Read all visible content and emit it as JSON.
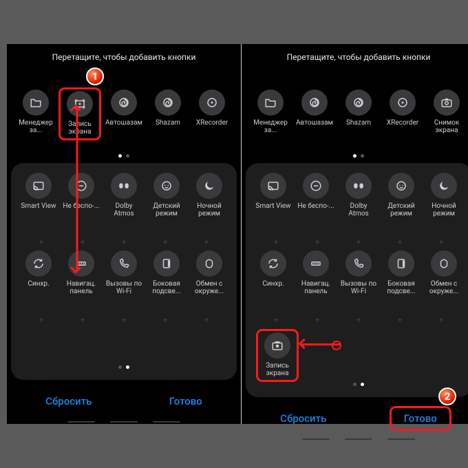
{
  "instruction": "Перетащите, чтобы добавить кнопки",
  "footer": {
    "reset": "Сбросить",
    "done": "Готово"
  },
  "badges": {
    "one": "1",
    "two": "2"
  },
  "left": {
    "available": [
      {
        "label": "Менеджер за...",
        "icon": "folder"
      },
      {
        "label": "Запись экрана",
        "icon": "record"
      },
      {
        "label": "Автошазам",
        "icon": "swirl"
      },
      {
        "label": "Shazam",
        "icon": "swirl"
      },
      {
        "label": "XRecorder",
        "icon": "disc"
      }
    ],
    "panel_r1": [
      {
        "label": "Smart View",
        "icon": "cast"
      },
      {
        "label": "Не беспо-...",
        "icon": "minus"
      },
      {
        "label": "Dolby Atmos",
        "icon": "dolby"
      },
      {
        "label": "Детский режим",
        "icon": "kid"
      },
      {
        "label": "Ночной режим",
        "icon": "moon"
      }
    ],
    "panel_r2": [
      {
        "label": "Синхр.",
        "icon": "sync"
      },
      {
        "label": "Навигац. панель",
        "icon": "nav"
      },
      {
        "label": "Вызовы по Wi-Fi",
        "icon": "wifi-call"
      },
      {
        "label": "Боковая подсве...",
        "icon": "edge"
      },
      {
        "label": "Обмен с окруже...",
        "icon": "share"
      }
    ]
  },
  "right": {
    "available": [
      {
        "label": "Менеджер за...",
        "icon": "folder"
      },
      {
        "label": "Автошазам",
        "icon": "swirl"
      },
      {
        "label": "Shazam",
        "icon": "swirl"
      },
      {
        "label": "XRecorder",
        "icon": "disc"
      },
      {
        "label": "Снимок экрана",
        "icon": "camera"
      }
    ],
    "panel_r1": [
      {
        "label": "Smart View",
        "icon": "cast"
      },
      {
        "label": "Не беспо-...",
        "icon": "minus"
      },
      {
        "label": "Dolby Atmos",
        "icon": "dolby"
      },
      {
        "label": "Детский режим",
        "icon": "kid"
      },
      {
        "label": "Ночной режим",
        "icon": "moon"
      }
    ],
    "panel_r2": [
      {
        "label": "Синхр.",
        "icon": "sync"
      },
      {
        "label": "Навигац. панель",
        "icon": "nav"
      },
      {
        "label": "Вызовы по Wi-Fi",
        "icon": "wifi-call"
      },
      {
        "label": "Боковая подсве...",
        "icon": "edge"
      },
      {
        "label": "Обмен с окруже...",
        "icon": "share"
      }
    ],
    "dropped": {
      "label": "Запись экрана",
      "icon": "record"
    }
  }
}
